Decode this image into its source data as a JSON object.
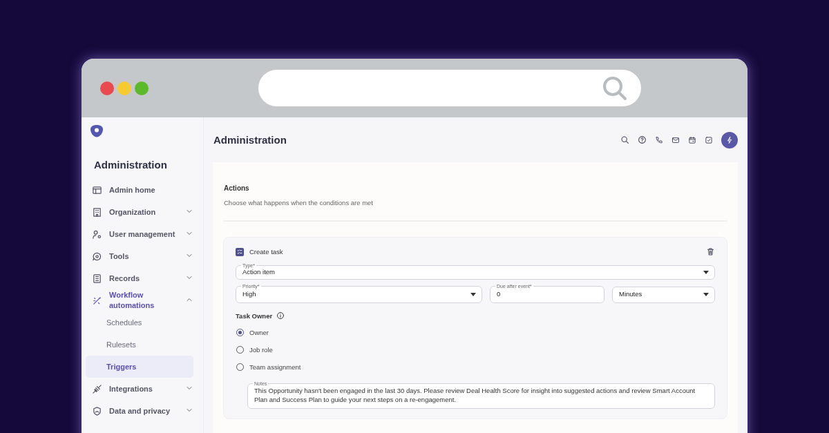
{
  "sidebar": {
    "title": "Administration",
    "items": [
      {
        "label": "Admin home",
        "kind": "link",
        "selected": false
      },
      {
        "label": "Organization",
        "kind": "group",
        "expanded": false,
        "selected": false
      },
      {
        "label": "User management",
        "kind": "group",
        "expanded": false,
        "selected": false
      },
      {
        "label": "Tools",
        "kind": "group",
        "expanded": false,
        "selected": false
      },
      {
        "label": "Records",
        "kind": "group",
        "expanded": false,
        "selected": false
      },
      {
        "label": "Workflow automations",
        "kind": "group",
        "expanded": true,
        "selected": true,
        "children": [
          {
            "label": "Schedules",
            "selected": false
          },
          {
            "label": "Rulesets",
            "selected": false
          },
          {
            "label": "Triggers",
            "selected": true
          }
        ]
      },
      {
        "label": "Integrations",
        "kind": "group",
        "expanded": false,
        "selected": false
      },
      {
        "label": "Data and privacy",
        "kind": "group",
        "expanded": false,
        "selected": false
      }
    ]
  },
  "header": {
    "title": "Administration"
  },
  "actions": {
    "title": "Actions",
    "subtitle": "Choose what happens when the conditions are met",
    "task": {
      "title": "Create task",
      "type_field": {
        "label": "Type*",
        "value": "Action item"
      },
      "row_fields": [
        {
          "kind": "select",
          "label": "Priority*",
          "value": "High"
        },
        {
          "kind": "input",
          "label": "Due after event*",
          "value": "0"
        },
        {
          "kind": "select",
          "value": "Minutes"
        }
      ],
      "owner_label": "Task Owner",
      "owner_options": [
        {
          "label": "Owner",
          "selected": true
        },
        {
          "label": "Job role",
          "selected": false
        },
        {
          "label": "Team assignment",
          "selected": false
        }
      ],
      "notes": {
        "label": "Notes",
        "value": "This Opportunity hasn't been engaged in the last 30 days. Please review Deal Health Score for insight into suggested actions and review Smart Account Plan and Success Plan to guide your next steps on a re-engagement."
      }
    }
  }
}
